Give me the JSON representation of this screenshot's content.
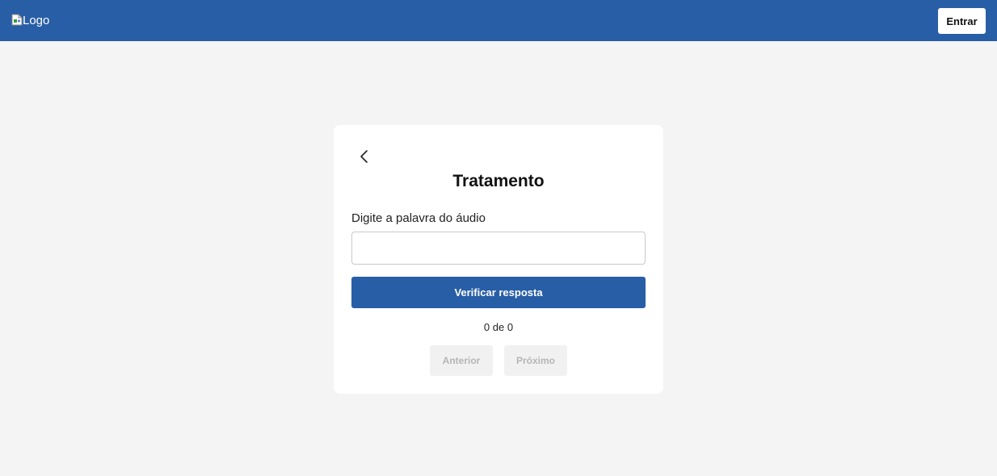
{
  "header": {
    "logo_alt": "Logo",
    "login_label": "Entrar"
  },
  "card": {
    "title": "Tratamento",
    "field_label": "Digite a palavra do áudio",
    "input_value": "",
    "input_placeholder": "",
    "verify_label": "Verificar resposta",
    "counter": "0 de 0",
    "prev_label": "Anterior",
    "next_label": "Próximo"
  },
  "colors": {
    "brand_blue": "#285ea6",
    "page_bg": "#f4f4f4",
    "disabled_bg": "#f1f1f1",
    "disabled_text": "#b5b5b5"
  },
  "icons": {
    "logo": "broken-image-icon",
    "back": "chevron-left-icon"
  }
}
